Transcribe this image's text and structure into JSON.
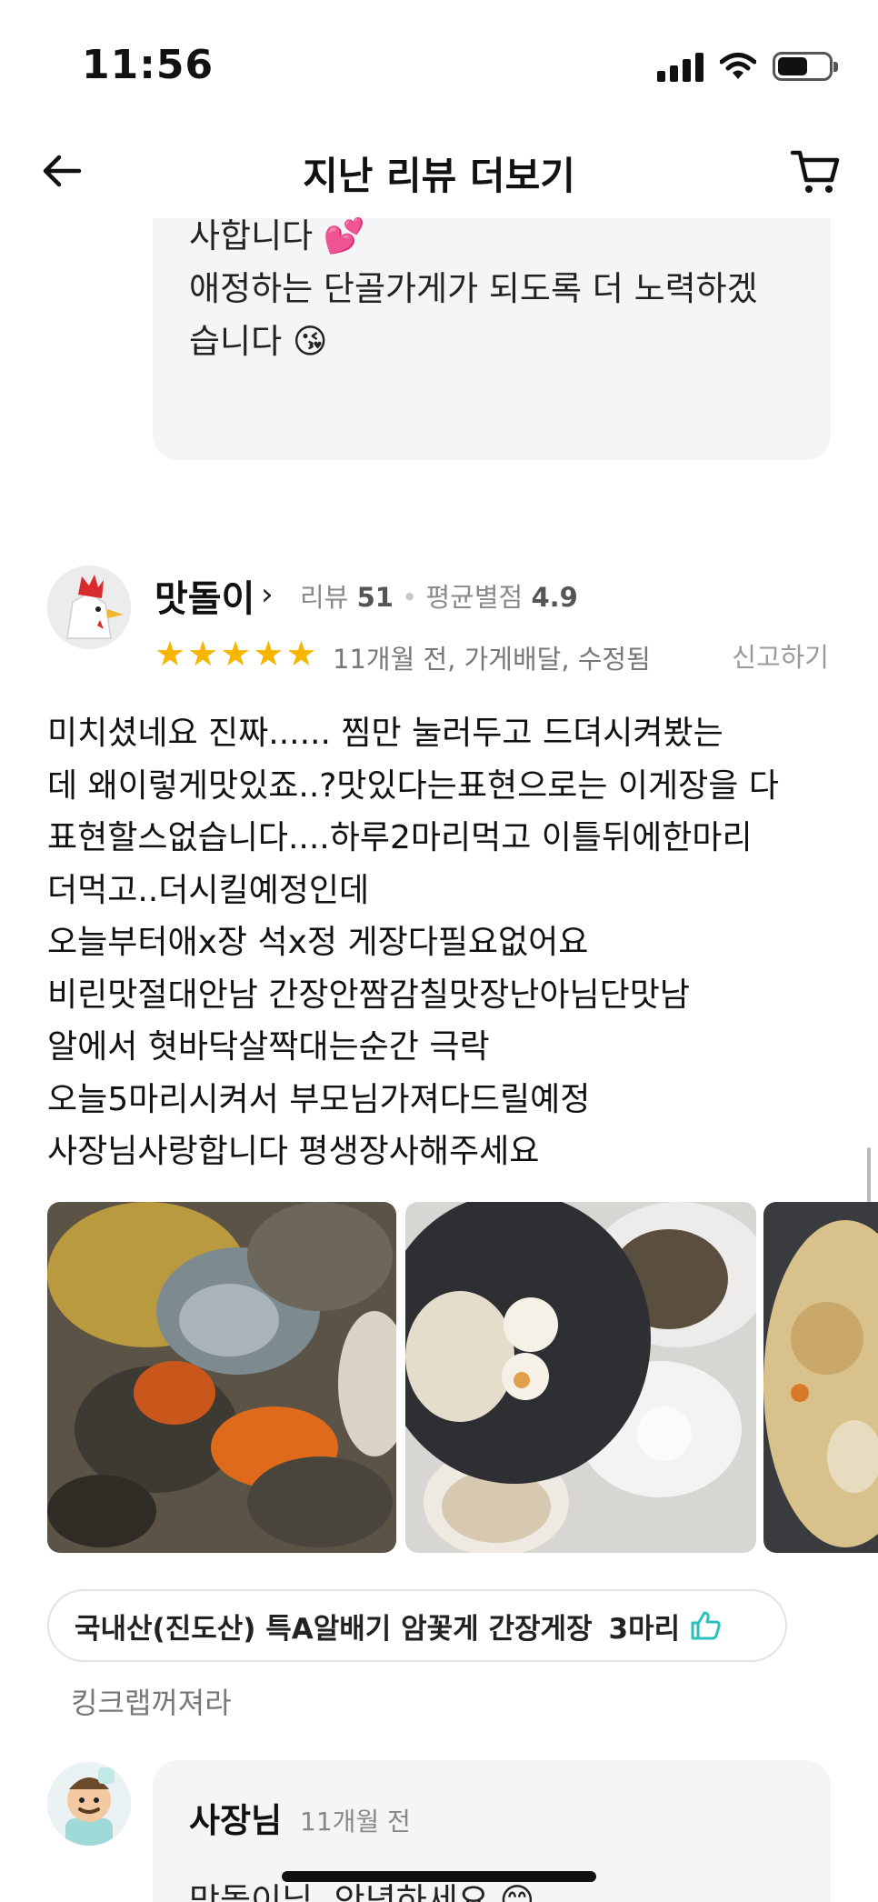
{
  "status_bar": {
    "time": "11:56",
    "battery_level": 0.6
  },
  "header": {
    "title": "지난 리뷰 더보기",
    "back_icon": "arrow-left-icon",
    "cart_icon": "cart-icon"
  },
  "prev_reply": {
    "lines": [
      "사합니다 💕",
      "애정하는 단골가게가 되도록 더 노력하겠",
      "습니다 😘"
    ]
  },
  "review": {
    "reviewer_name": "맛돌이",
    "review_count_label": "리뷰",
    "review_count": "51",
    "avg_rating_label": "평균별점",
    "avg_rating": "4.9",
    "stars": 5,
    "date_info": "11개월 전, 가게배달, 수정됨",
    "report": "신고하기",
    "body_lines": [
      "미치셨네요 진짜...... 찜만 눌러두고 드뎌시켜봤는",
      "데 왜이렇게맛있죠..?맛있다는표현으로는 이게장을 다",
      "표현할스없습니다....하루2마리먹고 이틀뒤에한마리",
      "더먹고..더시킬예정인데",
      "오늘부터애x장 석x정 게장다필요없어요",
      "비린맛절대안남 간장안짬감칠맛장난아님단맛남",
      "알에서 혓바닥살짝대는순간 극락",
      "오늘5마리시켜서 부모님가져다드릴예정",
      "사장님사랑합니다 평생장사해주세요"
    ],
    "photo_count": 3,
    "menu_name": "국내산(진도산) 특A알배기 암꽃게 간장게장",
    "menu_qty": "3마리",
    "option_text": "킹크랩꺼져라"
  },
  "owner_reply": {
    "name": "사장님",
    "time": "11개월 전",
    "greeting": "맛돌이님, 안녕하세요 😊"
  },
  "colors": {
    "star": "#f7b500",
    "thumb": "#2ac1bc",
    "reply_bg": "#f4f5f7"
  }
}
